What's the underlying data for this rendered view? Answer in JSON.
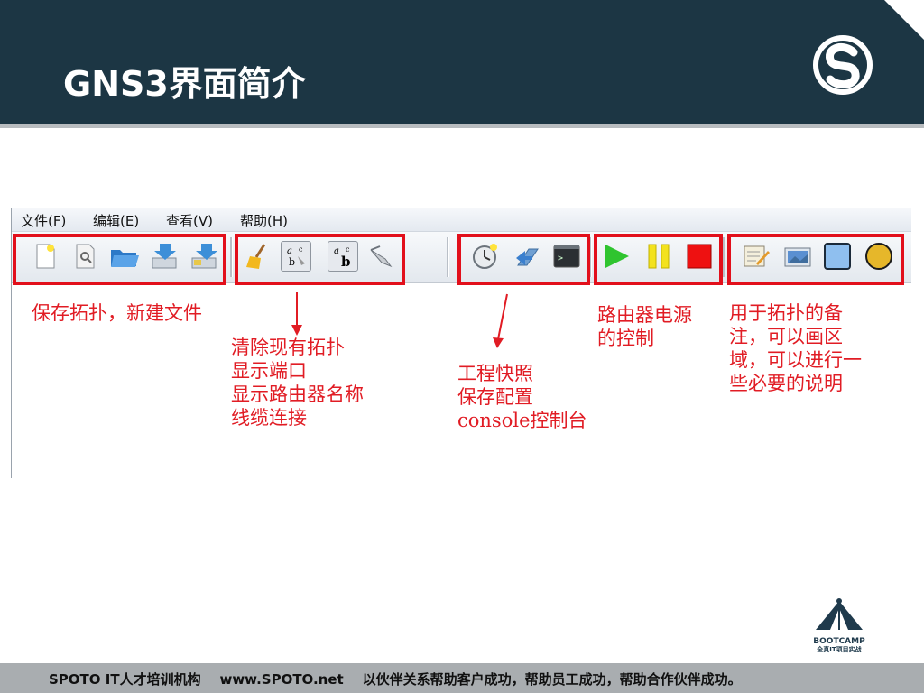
{
  "header": {
    "title": "GNS3界面简介"
  },
  "menu": [
    {
      "label": "文件(F)"
    },
    {
      "label": "编辑(E)"
    },
    {
      "label": "查看(V)"
    },
    {
      "label": "帮助(H)"
    }
  ],
  "toolbar": {
    "groups": [
      {
        "name": "file",
        "buttons": [
          "new-file-icon",
          "open-file-icon",
          "open-folder-icon",
          "save-icon",
          "save-as-icon"
        ]
      },
      {
        "name": "topology",
        "buttons": [
          "broom-icon",
          "interface-labels-icon",
          "hostname-labels-icon",
          "cable-icon"
        ]
      },
      {
        "name": "snapshot",
        "buttons": [
          "snapshot-icon",
          "save-config-icon",
          "console-icon"
        ]
      },
      {
        "name": "power",
        "buttons": [
          "play-icon",
          "pause-icon",
          "stop-icon"
        ]
      },
      {
        "name": "annotate",
        "buttons": [
          "note-icon",
          "picture-icon",
          "rectangle-icon",
          "ellipse-icon"
        ]
      }
    ]
  },
  "annotations": {
    "file": "保存拓扑，新建文件",
    "topology": [
      "清除现有拓扑",
      "显示端口",
      "显示路由器名称",
      "线缆连接"
    ],
    "snapshot": [
      "工程快照",
      "保存配置",
      "console控制台"
    ],
    "power": [
      "路由器电源",
      "的控制"
    ],
    "annotate": [
      "用于拓扑的备",
      "注，可以画区",
      "域，可以进行一",
      "些必要的说明"
    ]
  },
  "colors": {
    "header_bg": "#1c3644",
    "annotation_red": "#e11c24",
    "footer_bg": "#a9adb0"
  },
  "bootcamp": {
    "label": "BOOTCAMP",
    "sub": "全真IT项目实战"
  },
  "footer": {
    "text": "SPOTO IT人才培训机构    www.SPOTO.net    以伙伴关系帮助客户成功，帮助员工成功，帮助合作伙伴成功。"
  }
}
